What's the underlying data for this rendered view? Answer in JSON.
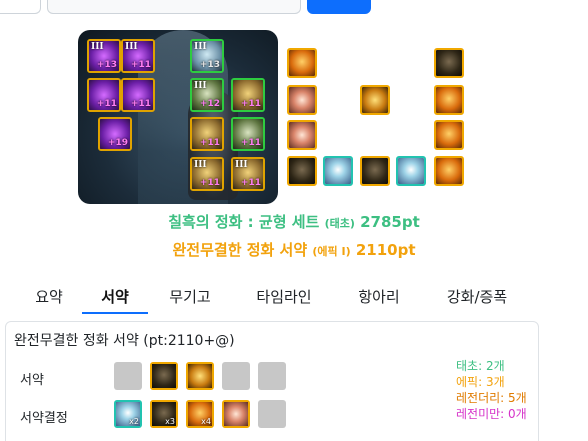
{
  "equipment": [
    {
      "tier": "III",
      "level": "+13"
    },
    {
      "tier": "III",
      "level": "+11"
    },
    {
      "tier": "III",
      "level": "+13"
    },
    {
      "tier": "",
      "level": "+11"
    },
    {
      "tier": "",
      "level": "+11"
    },
    {
      "tier": "III",
      "level": "+12"
    },
    {
      "tier": "",
      "level": "+11"
    },
    {
      "tier": "",
      "level": "+19"
    },
    {
      "tier": "",
      "level": "+11"
    },
    {
      "tier": "",
      "level": "+11"
    },
    {
      "tier": "III",
      "level": "+11"
    },
    {
      "tier": "III",
      "level": "+11"
    }
  ],
  "set_line1": {
    "name": "칠흑의 정화 : 균형 세트",
    "grade": "(태초)",
    "points": "2785pt",
    "color": "#3dbf82"
  },
  "set_line2": {
    "name": "완전무결한 정화 서약",
    "grade": "(에픽 Ⅰ)",
    "points": "2110pt",
    "color": "#f2a20d"
  },
  "tabs": [
    {
      "label": "요약",
      "active": false
    },
    {
      "label": "서약",
      "active": true
    },
    {
      "label": "무기고",
      "active": false
    },
    {
      "label": "타임라인",
      "active": false
    },
    {
      "label": "항아리",
      "active": false
    },
    {
      "label": "강화/증폭",
      "active": false
    }
  ],
  "panel": {
    "title": "완전무결한 정화 서약 (pt:2110+@)",
    "row1_label": "서약",
    "row2_label": "서약결정",
    "row2_counts": [
      "x2",
      "x3",
      "x4",
      ""
    ]
  },
  "grade_counts": [
    {
      "label": "태초: 2개",
      "color": "#3dbf82"
    },
    {
      "label": "에픽: 3개",
      "color": "#f2a20d"
    },
    {
      "label": "레전더리: 5개",
      "color": "#e07b00"
    },
    {
      "label": "레전미만: 0개",
      "color": "#d633c9"
    }
  ]
}
